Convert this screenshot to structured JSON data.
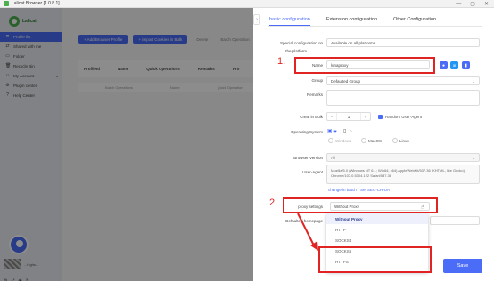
{
  "window": {
    "title": "Lalicat Browser  [1.0.8.1]",
    "controls": [
      "—",
      "▢",
      "✕"
    ]
  },
  "sidebar": {
    "logo_text": "Lalicat",
    "items": [
      {
        "label": "Profile list",
        "icon": "≣",
        "active": true
      },
      {
        "label": "Shared with me",
        "icon": "⇄"
      },
      {
        "label": "Folder",
        "icon": "▭"
      },
      {
        "label": "Recycle Bin",
        "icon": "🗑"
      },
      {
        "label": "My Account",
        "icon": "☺",
        "chevron": "⌄"
      },
      {
        "label": "Plugin center",
        "icon": "⚙"
      },
      {
        "label": "Help Center",
        "icon": "?"
      }
    ],
    "username": "...highs...",
    "bottom_icons": [
      "⚙",
      "⤢",
      "◉",
      "↻"
    ]
  },
  "main": {
    "add_profile_label": "+ Add Browser Profile",
    "import_label": "+ Import Cookies in Bulk",
    "ghost_buttons": [
      "Delete",
      "Batch Operation"
    ],
    "table_headers": [
      "ProfileId",
      "Name",
      "Quick Operations",
      "Remarks",
      "Pro"
    ],
    "row_cells": [
      "Batch Operations",
      "Name",
      "Quick Operation"
    ]
  },
  "drawer": {
    "collapse_icon": "›",
    "tabs": [
      {
        "label": "basic configuration",
        "active": true
      },
      {
        "label": "Extension configuration"
      },
      {
        "label": "Other Configuration"
      }
    ],
    "special_config_label": "Special configuration on",
    "special_config_sub": "the platform",
    "special_config_value": "Available on all platforms",
    "name_label": "Name",
    "name_value": "lunaproxy",
    "group_label": "Group",
    "group_value": "Defaulted Group",
    "remarks_label": "Remarks",
    "create_bulk_label": "Creat in Bulk",
    "create_bulk_value": "1",
    "random_ua_label": "Random User-Agent",
    "os_label": "Operating System",
    "os_options": [
      "Windows",
      "MacOS",
      "Linux"
    ],
    "browser_version_label": "Browser Version",
    "browser_version_value": "All",
    "ua_label": "User-Agent",
    "ua_value": "Mozilla/5.0 (Windows NT 6.1; Win64; x64) AppleWebKit/537.36 (KHTML, like Gecko) Chrome/107.0.5304.122 Safari/537.36",
    "change_batch_label": "change in batch",
    "set_sec_label": "Set SEC-CH-UA",
    "proxy_label": "proxy settings",
    "proxy_value": "Without Proxy",
    "default_lang_label": "Defaulted homepage",
    "dropdown_options": [
      {
        "label": "Without Proxy",
        "selected": true
      },
      {
        "label": "HTTP"
      },
      {
        "label": "SOCKS4"
      },
      {
        "label": "SOCKS5"
      },
      {
        "label": "HTTPS"
      }
    ],
    "save_label": "Save"
  },
  "annotations": {
    "step1": "1.",
    "step2": "2."
  },
  "colors": {
    "accent": "#4a6cf7",
    "annotation_red": "#e02424",
    "brand_green": "#4caf50"
  }
}
